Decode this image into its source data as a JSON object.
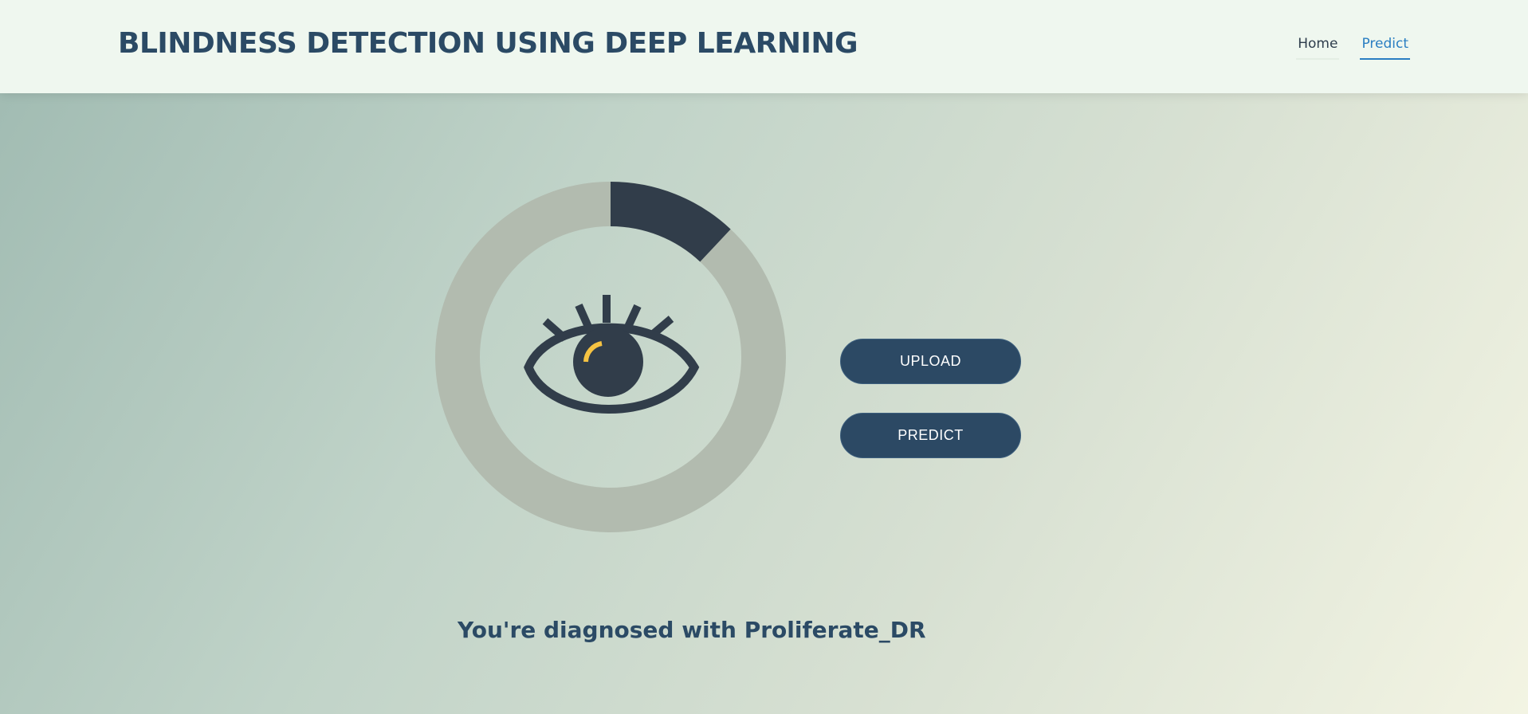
{
  "header": {
    "title": "BLINDNESS DETECTION USING DEEP LEARNING",
    "nav": {
      "home_label": "Home",
      "predict_label": "Predict",
      "active": "Predict"
    }
  },
  "main": {
    "progress": {
      "fraction": 0.12,
      "fill_color": "#313d4a",
      "track_color": "#b2bbaf"
    },
    "eye_icon": {
      "icon": "eye-icon",
      "color": "#313d4a",
      "highlight_color": "#f6c342"
    },
    "buttons": {
      "upload_label": "UPLOAD",
      "predict_label": "PREDICT"
    },
    "result_text": "You're diagnosed with Proliferate_DR"
  },
  "colors": {
    "brand": "#2b4a65",
    "header_bg": "#eff7ef",
    "button_bg": "#2c4964",
    "link_active": "#2a7ec2"
  }
}
